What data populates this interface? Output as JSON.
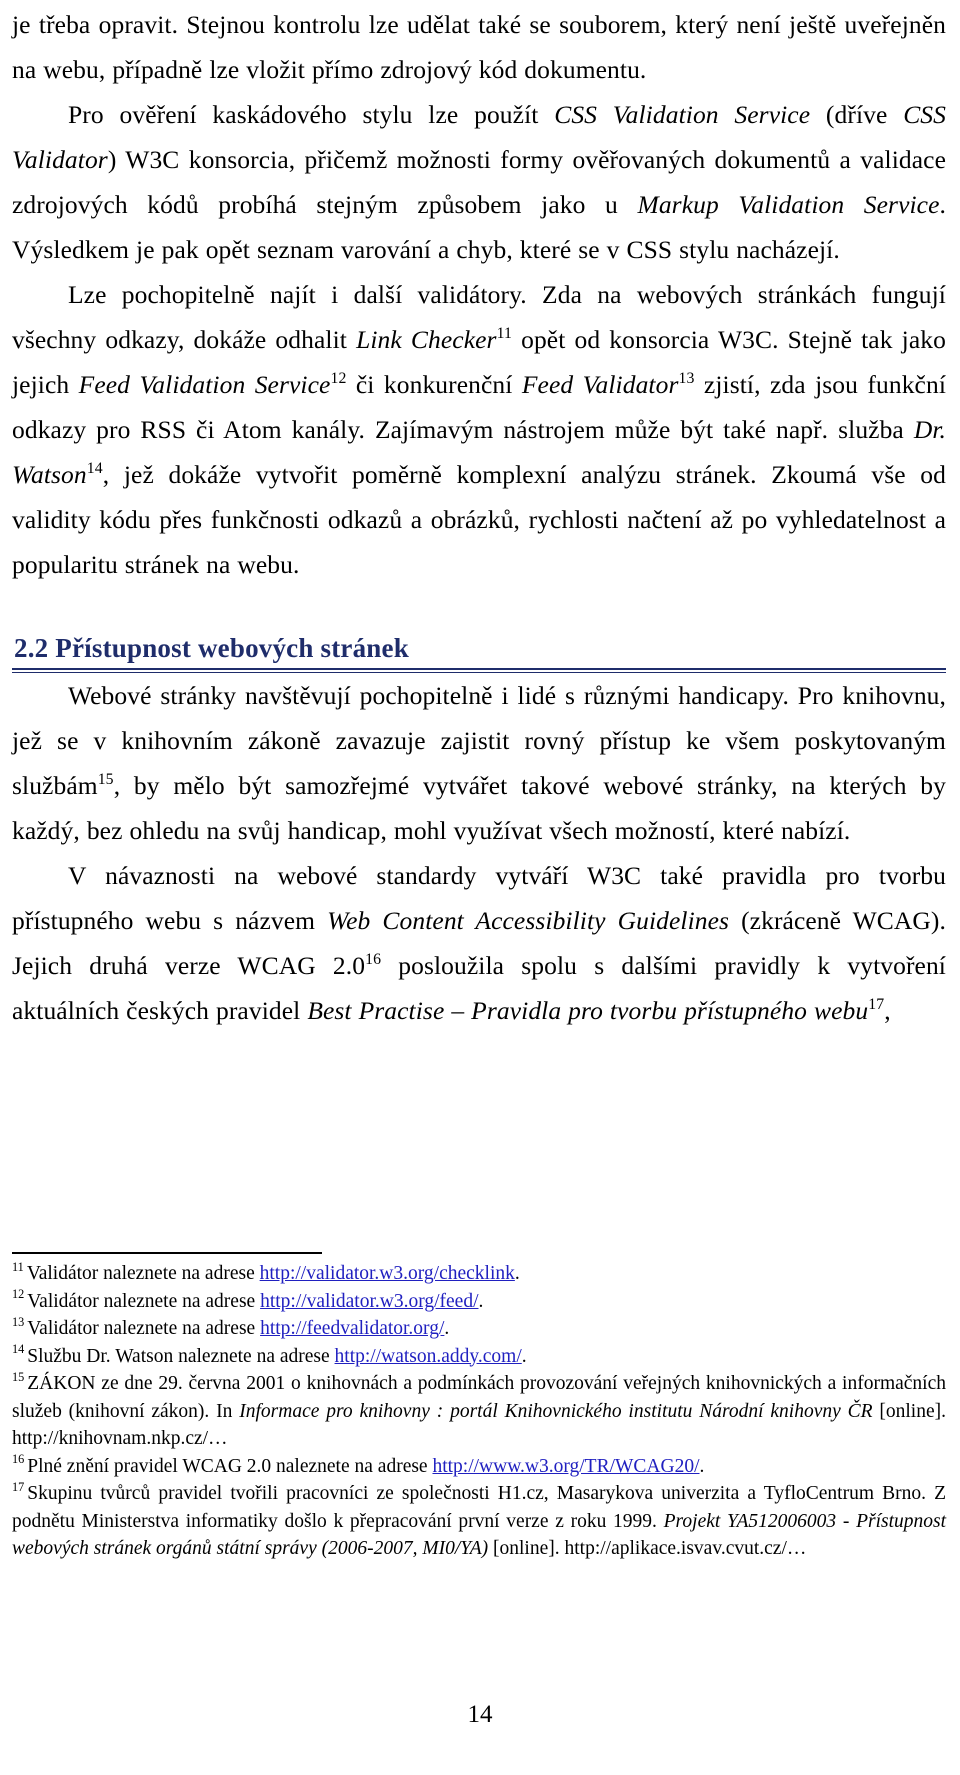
{
  "document": {
    "page_number": "14",
    "heading_color": "#1F2D6B",
    "link_color": "#2020C0"
  },
  "body": {
    "para1_a": "je třeba opravit. Stejnou kontrolu lze udělat také se souborem, který není ještě uveřejněn na webu, ",
    "para1_b": "případně lze vložit přímo zdrojový kód dokumentu.",
    "para2_a": "Pro ověření kaskádového stylu lze použít ",
    "para2_em1": "CSS Validation Service",
    "para2_b": " (dříve ",
    "para2_em2": "CSS Validator",
    "para2_c": ") W3C konsorcia, přičemž možnosti formy ověřovaných dokumentů a validace zdrojových kódů probíhá stejným způsobem jako u ",
    "para2_em3": "Markup Validation Service",
    "para2_d": ". Výsledkem je pak opět seznam varování a chyb, které se v CSS stylu nacházejí.",
    "para3_a": "Lze pochopitelně najít i další validátory. Zda na webových stránkách fungují všechny odkazy, dokáže odhalit ",
    "para3_em1": "Link Checker",
    "para3_sup1": "11",
    "para3_b": " opět od konsorcia W3C. Stejně tak jako jejich ",
    "para3_em2": "Feed Validation Service",
    "para3_sup2": "12",
    "para3_c": " či konkurenční ",
    "para3_em3": "Feed Validator",
    "para3_sup3": "13",
    "para3_d": " zjistí, zda jsou funkční odkazy pro RSS či Atom kanály. Zajímavým nástrojem může být také např. služba ",
    "para3_em4": "Dr. Watson",
    "para3_sup4": "14",
    "para3_e": ", jež dokáže vytvořit poměrně komplexní analýzu stránek. Zkoumá vše od validity kódu přes funkčnosti odkazů a obrázků, rychlosti načtení až po vyhledatelnost a popularitu stránek na webu.",
    "heading": "2.2 Přístupnost webových stránek",
    "para4_a": "Webové stránky navštěvují pochopitelně i lidé s různými handicapy. Pro knihovnu, jež se v knihovním zákoně zavazuje zajistit rovný přístup ke všem poskytovaným službám",
    "para4_sup1": "15",
    "para4_b": ", by mělo být samozřejmé vytvářet takové webové stránky, na kterých by každý, bez ohledu na svůj handicap, mohl využívat všech možností, které nabízí.",
    "para5_a": "V návaznosti na webové standardy vytváří W3C také pravidla pro tvorbu přístupného webu s názvem ",
    "para5_em1": "Web Content Accessibility Guidelines",
    "para5_b": " (zkráceně WCAG). Jejich druhá verze WCAG 2.0",
    "para5_sup1": "16",
    "para5_c": " posloužila spolu s dalšími pravidly k vytvoření aktuálních českých pravidel ",
    "para5_em2": "Best Practise – Pravidla pro tvorbu přístupného webu",
    "para5_sup2": "17",
    "para5_d": ","
  },
  "footnotes": [
    {
      "num": "11",
      "text_before": "Validátor naleznete na adrese ",
      "url": "http://validator.w3.org/checklink",
      "text_after": "."
    },
    {
      "num": "12",
      "text_before": "Validátor naleznete na adrese ",
      "url": "http://validator.w3.org/feed/",
      "text_after": "."
    },
    {
      "num": "13",
      "text_before": "Validátor naleznete na adrese ",
      "url": "http://feedvalidator.org/",
      "text_after": "."
    },
    {
      "num": "14",
      "text_before": "Službu Dr. Watson naleznete na adrese ",
      "url": "http://watson.addy.com/",
      "text_after": "."
    },
    {
      "num": "15",
      "text_before": "ZÁKON ze dne 29. června 2001 o knihovnách a podmínkách provozování veřejných knihovnických a informačních služeb (knihovní zákon). In ",
      "em1": "Informace pro knihovny : portál Knihovnického institutu Národní knihovny ČR",
      "text_mid": " [online]. ",
      "url_plain": "http://knihovnam.nkp.cz/…",
      "text_after": ""
    },
    {
      "num": "16",
      "text_before": "Plné znění pravidel WCAG 2.0 naleznete na adrese ",
      "url": "http://www.w3.org/TR/WCAG20/",
      "text_after": "."
    },
    {
      "num": "17",
      "text_before": "Skupinu tvůrců pravidel tvořili pracovníci ze společnosti H1.cz, Masarykova univerzita a TyfloCentrum Brno. Z podnětu Ministerstva informatiky došlo k přepracování první verze z roku 1999. ",
      "em1": "Projekt YA512006003 - Přístupnost webových stránek orgánů státní správy (2006-2007, MI0/YA)",
      "text_mid": " [online]. ",
      "url_plain": "http://aplikace.isvav.cvut.cz/…",
      "text_after": ""
    }
  ]
}
